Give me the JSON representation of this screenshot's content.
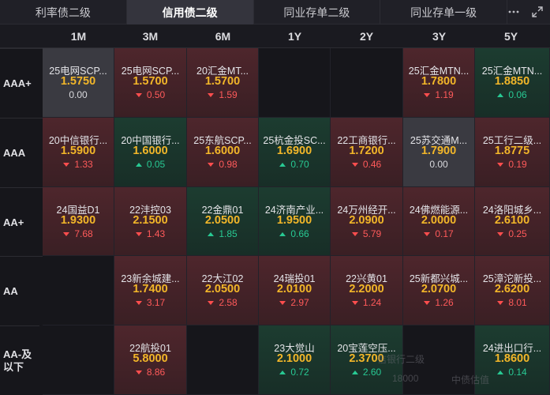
{
  "tabs": [
    {
      "label": "利率债二级",
      "active": false
    },
    {
      "label": "信用债二级",
      "active": true
    },
    {
      "label": "同业存单二级",
      "active": false
    },
    {
      "label": "同业存单一级",
      "active": false
    }
  ],
  "toolbar": {
    "more_icon": "more-dots-icon",
    "expand_icon": "expand-icon"
  },
  "columns": [
    "1M",
    "3M",
    "6M",
    "1Y",
    "2Y",
    "3Y",
    "5Y"
  ],
  "rows": [
    {
      "label": "AAA+",
      "cells": [
        {
          "name": "25电网SCP...",
          "rate": "1.5750",
          "change": "0.00",
          "dir": "flat",
          "bg": "grey"
        },
        {
          "name": "25电网SCP...",
          "rate": "1.5700",
          "change": "0.50",
          "dir": "down",
          "bg": "red"
        },
        {
          "name": "20汇金MT...",
          "rate": "1.5700",
          "change": "1.59",
          "dir": "down",
          "bg": "red"
        },
        null,
        null,
        {
          "name": "25汇金MTN...",
          "rate": "1.7800",
          "change": "1.19",
          "dir": "down",
          "bg": "red"
        },
        {
          "name": "25汇金MTN...",
          "rate": "1.8850",
          "change": "0.06",
          "dir": "up",
          "bg": "green"
        }
      ]
    },
    {
      "label": "AAA",
      "cells": [
        {
          "name": "20中信银行...",
          "rate": "1.5900",
          "change": "1.33",
          "dir": "down",
          "bg": "red"
        },
        {
          "name": "20中国银行...",
          "rate": "1.6000",
          "change": "0.05",
          "dir": "up",
          "bg": "green"
        },
        {
          "name": "25东航SCP...",
          "rate": "1.6000",
          "change": "0.98",
          "dir": "down",
          "bg": "red"
        },
        {
          "name": "25杭金投SC...",
          "rate": "1.6900",
          "change": "0.70",
          "dir": "up",
          "bg": "green"
        },
        {
          "name": "22工商银行...",
          "rate": "1.7200",
          "change": "0.46",
          "dir": "down",
          "bg": "red"
        },
        {
          "name": "25苏交通M...",
          "rate": "1.7900",
          "change": "0.00",
          "dir": "flat",
          "bg": "grey"
        },
        {
          "name": "25工行二级...",
          "rate": "1.8775",
          "change": "0.19",
          "dir": "down",
          "bg": "red"
        }
      ]
    },
    {
      "label": "AA+",
      "cells": [
        {
          "name": "24国益D1",
          "rate": "1.9300",
          "change": "7.68",
          "dir": "down",
          "bg": "red"
        },
        {
          "name": "22沣控03",
          "rate": "2.1500",
          "change": "1.43",
          "dir": "down",
          "bg": "red"
        },
        {
          "name": "22金鼎01",
          "rate": "2.0500",
          "change": "1.85",
          "dir": "up",
          "bg": "green"
        },
        {
          "name": "24济南产业...",
          "rate": "1.9500",
          "change": "0.66",
          "dir": "up",
          "bg": "green"
        },
        {
          "name": "24万州经开...",
          "rate": "2.0900",
          "change": "5.79",
          "dir": "down",
          "bg": "red"
        },
        {
          "name": "24佛燃能源...",
          "rate": "2.0000",
          "change": "0.17",
          "dir": "down",
          "bg": "red"
        },
        {
          "name": "24洛阳城乡...",
          "rate": "2.6100",
          "change": "0.25",
          "dir": "down",
          "bg": "red"
        }
      ]
    },
    {
      "label": "AA",
      "cells": [
        null,
        {
          "name": "23新余城建...",
          "rate": "1.7400",
          "change": "3.17",
          "dir": "down",
          "bg": "red"
        },
        {
          "name": "22大江02",
          "rate": "2.0500",
          "change": "2.58",
          "dir": "down",
          "bg": "red"
        },
        {
          "name": "24瑞投01",
          "rate": "2.0100",
          "change": "2.97",
          "dir": "down",
          "bg": "red"
        },
        {
          "name": "22兴黄01",
          "rate": "2.2000",
          "change": "1.24",
          "dir": "down",
          "bg": "red"
        },
        {
          "name": "25新都兴城...",
          "rate": "2.0700",
          "change": "1.26",
          "dir": "down",
          "bg": "red"
        },
        {
          "name": "25漳沱新投...",
          "rate": "2.6200",
          "change": "8.01",
          "dir": "down",
          "bg": "red"
        }
      ]
    },
    {
      "label": "AA-及以下",
      "cells": [
        null,
        {
          "name": "22航投01",
          "rate": "5.8000",
          "change": "8.86",
          "dir": "down",
          "bg": "red"
        },
        null,
        {
          "name": "23大觉山",
          "rate": "2.1000",
          "change": "0.72",
          "dir": "up",
          "bg": "green"
        },
        {
          "name": "20宝莲空压...",
          "rate": "2.3700",
          "change": "2.60",
          "dir": "up",
          "bg": "green"
        },
        null,
        {
          "name": "24进出口行...",
          "rate": "1.8600",
          "change": "0.14",
          "dir": "up",
          "bg": "green"
        }
      ]
    }
  ],
  "overlay": {
    "ghost_text_1": "信银行二级",
    "ghost_text_2": "18000",
    "ghost_text_3": "中债估值"
  }
}
